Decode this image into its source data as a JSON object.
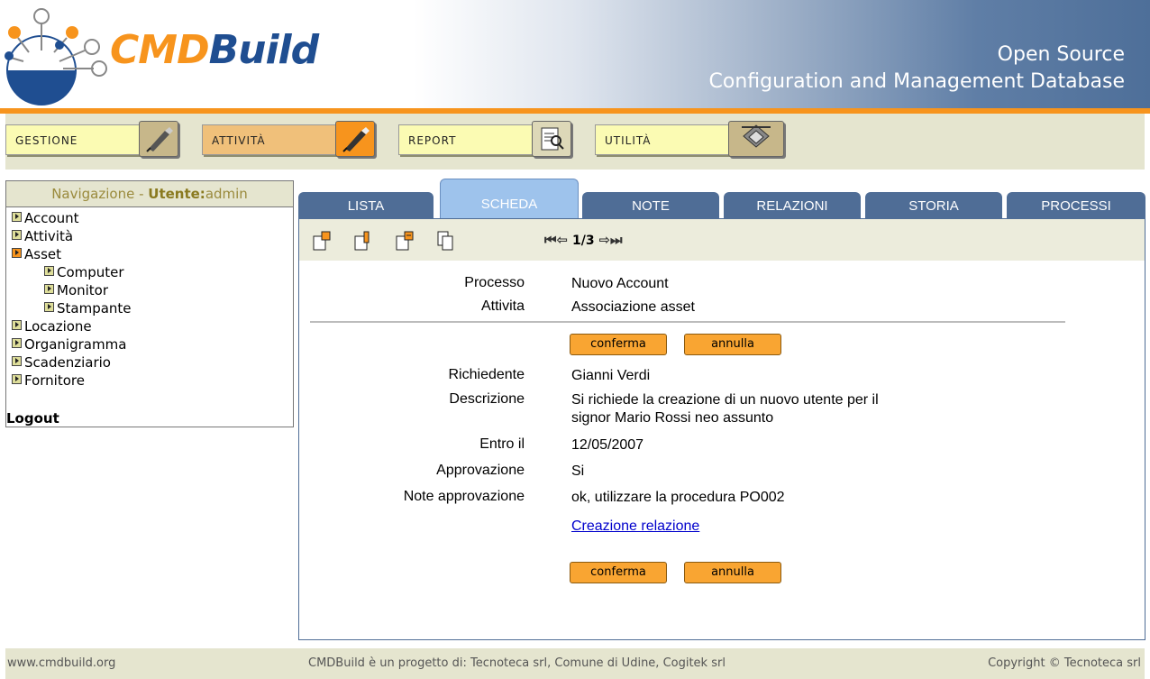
{
  "logo": {
    "part1": "CMD",
    "part2": "Build"
  },
  "tagline": {
    "line1": "Open Source",
    "line2": "Configuration and Management Database"
  },
  "menu": [
    {
      "label": "GESTIONE",
      "icon": "pen-icon"
    },
    {
      "label": "ATTIVITÀ",
      "icon": "pen-icon"
    },
    {
      "label": "REPORT",
      "icon": "report-search-icon"
    },
    {
      "label": "UTILITÀ",
      "icon": "tools-icon"
    }
  ],
  "nav": {
    "title_prefix": "Navigazione - ",
    "user_label": "Utente:",
    "user": "admin",
    "items": [
      "Account",
      "Attività",
      "Asset",
      "Computer",
      "Monitor",
      "Stampante",
      "Locazione",
      "Organigramma",
      "Scadenziario",
      "Fornitore"
    ],
    "logout": "Logout"
  },
  "tabs": [
    "LISTA",
    "SCHEDA",
    "NOTE",
    "RELAZIONI",
    "STORIA",
    "PROCESSI"
  ],
  "pager": {
    "text": "1/3"
  },
  "form": {
    "processo_label": "Processo",
    "processo_value": "Nuovo Account",
    "attivita_label": "Attivita",
    "attivita_value": "Associazione asset",
    "richiedente_label": "Richiedente",
    "richiedente_value": "Gianni Verdi",
    "descrizione_label": "Descrizione",
    "descrizione_line1": "Si richiede la creazione di un nuovo utente per il",
    "descrizione_line2": "signor Mario Rossi neo assunto",
    "entro_label": "Entro il",
    "entro_value": "12/05/2007",
    "approvazione_label": "Approvazione",
    "approvazione_value": "Si",
    "note_label": "Note approvazione",
    "note_value": "ok, utilizzare la procedura PO002",
    "link": "Creazione relazione",
    "confirm": "conferma",
    "cancel": "annulla"
  },
  "footer": {
    "left": "www.cmdbuild.org",
    "center": "CMDBuild è un progetto di: Tecnoteca srl, Comune di Udine, Cogitek srl",
    "right": "Copyright © Tecnoteca srl"
  }
}
